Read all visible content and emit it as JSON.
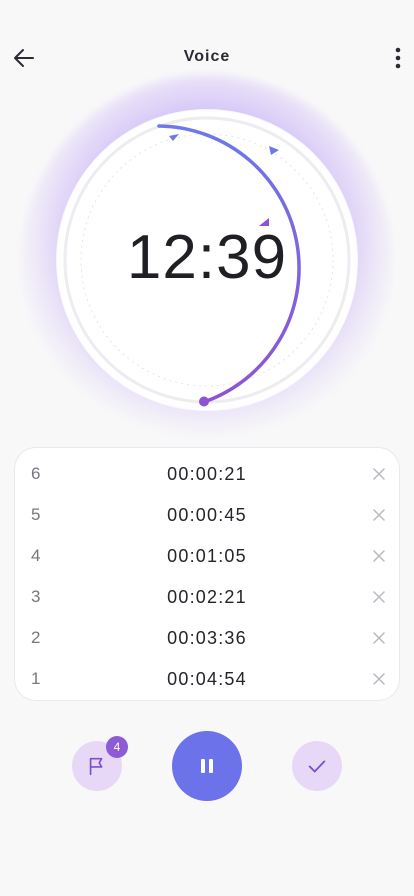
{
  "header": {
    "title": "Voice"
  },
  "timer": {
    "display": "12:39"
  },
  "laps": [
    {
      "number": "6",
      "time": "00:00:21"
    },
    {
      "number": "5",
      "time": "00:00:45"
    },
    {
      "number": "4",
      "time": "00:01:05"
    },
    {
      "number": "3",
      "time": "00:02:21"
    },
    {
      "number": "2",
      "time": "00:03:36"
    },
    {
      "number": "1",
      "time": "00:04:54"
    }
  ],
  "controls": {
    "flag_badge": "4"
  },
  "colors": {
    "accent": "#6b72ea",
    "accent_light": "#e7d8f7",
    "badge": "#8d5bd6",
    "arc_start": "#6e78e8",
    "arc_end": "#8f52d2"
  },
  "icons": {
    "back": "arrow-left-icon",
    "more": "more-vertical-icon",
    "flag": "flag-icon",
    "pause": "pause-icon",
    "check": "check-icon",
    "delete": "close-icon"
  }
}
